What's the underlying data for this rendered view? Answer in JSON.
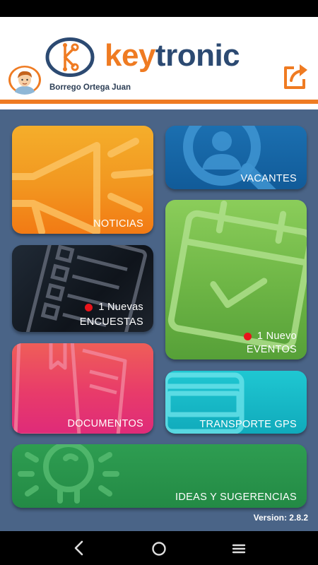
{
  "header": {
    "user_name": "Borrego Ortega Juan",
    "logo_prefix": "key",
    "logo_suffix": "tronic"
  },
  "tiles": {
    "noticias": {
      "label": "NOTICIAS"
    },
    "vacantes": {
      "label": "VACANTES"
    },
    "encuestas": {
      "label": "ENCUESTAS",
      "badge": "1  Nuevas"
    },
    "eventos": {
      "label": "EVENTOS",
      "badge": "1  Nuevo"
    },
    "documentos": {
      "label": "DOCUMENTOS"
    },
    "transporte": {
      "label": "TRANSPORTE GPS"
    },
    "ideas": {
      "label": "IDEAS Y SUGERENCIAS"
    }
  },
  "footer": {
    "version": "Version: 2.8.2"
  },
  "icons": {
    "avatar": "user-avatar-icon",
    "logo": "keytronic-logo-icon",
    "logout": "logout-icon",
    "noticias": "megaphone-icon",
    "vacantes": "search-person-icon",
    "encuestas": "survey-form-icon",
    "eventos": "calendar-check-icon",
    "documentos": "folder-document-icon",
    "transporte": "bus-icon",
    "ideas": "lightbulb-icon",
    "nav_back": "back-icon",
    "nav_home": "home-icon",
    "nav_menu": "menu-icon"
  },
  "colors": {
    "brand_orange": "#ef7b22",
    "brand_navy": "#2c4a72",
    "background": "#4a6487",
    "badge_dot": "#e8141b"
  }
}
